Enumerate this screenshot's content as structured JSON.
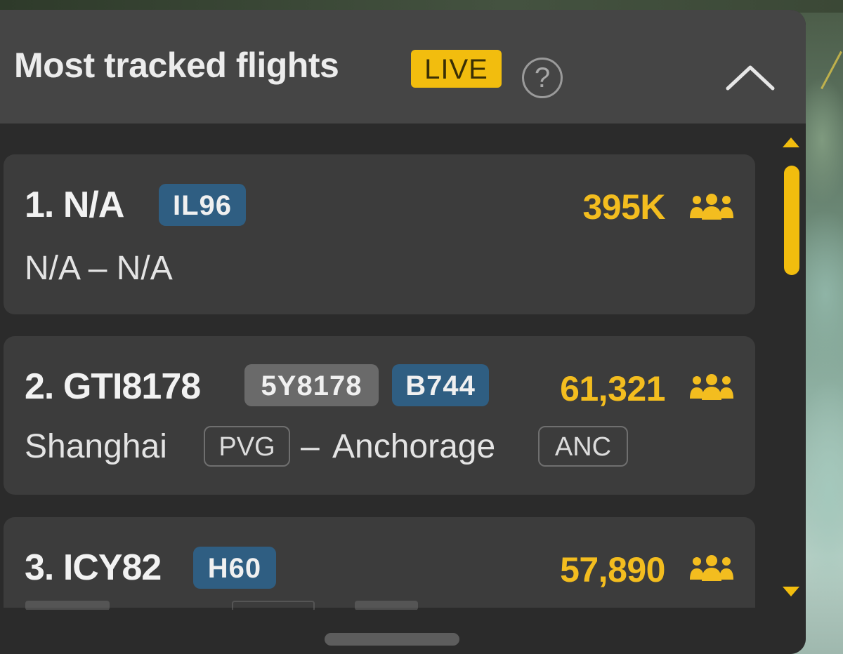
{
  "header": {
    "title": "Most tracked flights",
    "live_label": "LIVE",
    "help_glyph": "?",
    "help_icon": "question-circle-icon",
    "collapse_icon": "chevron-up-icon"
  },
  "flights": [
    {
      "title": "1. N/A",
      "tags": [
        "IL96"
      ],
      "count": "395K",
      "route": "N/A – N/A",
      "icon": "people-icon"
    },
    {
      "title": "2. GTI8178",
      "tags": [
        "5Y8178",
        "B744"
      ],
      "count": "61,321",
      "origin": "Shanghai",
      "origin_code": "PVG",
      "route_separator": "–",
      "destination": "Anchorage",
      "destination_code": "ANC",
      "icon": "people-icon"
    },
    {
      "title": "3. ICY82",
      "tags": [
        "H60"
      ],
      "count": "57,890",
      "icon": "people-icon"
    }
  ],
  "colors": {
    "accent": "#f2bd0e",
    "count_text": "#f3bd1f",
    "type_tag": "#2f5e82",
    "registration_tag": "#6a6a6a",
    "panel_bg": "#2b2b2b",
    "header_bg": "#454545",
    "card_bg": "#3c3c3c"
  }
}
